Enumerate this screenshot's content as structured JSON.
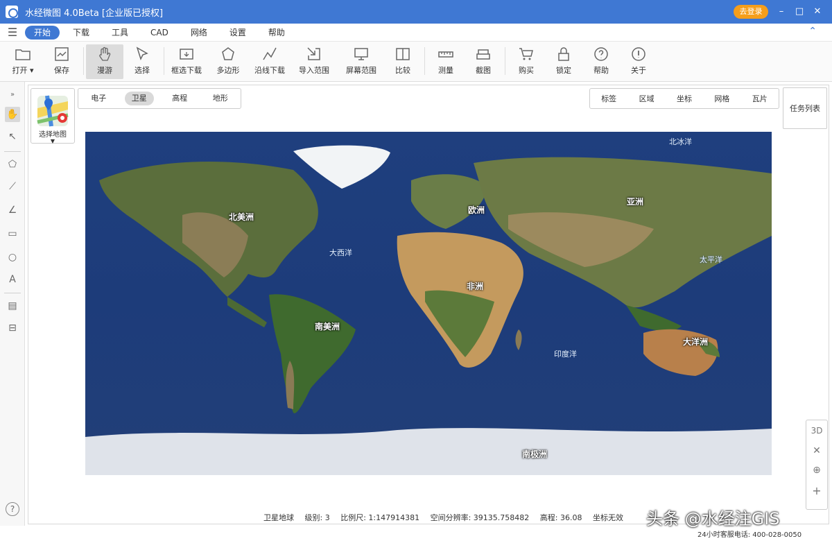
{
  "app": {
    "title": "水经微图 4.0Beta [企业版已授权]",
    "login_label": "去登录",
    "minimize": "–",
    "maximize": "□",
    "close": "✕"
  },
  "menu": {
    "toggle": "☰",
    "items": [
      "开始",
      "下载",
      "工具",
      "CAD",
      "网络",
      "设置",
      "帮助"
    ],
    "collapse": "⌃"
  },
  "toolbar": {
    "items": [
      "打开 ▾",
      "保存",
      "漫游",
      "选择",
      "框选下载",
      "多边形",
      "沿线下载",
      "导入范围",
      "屏幕范围",
      "比较",
      "测量",
      "截图",
      "购买",
      "锁定",
      "帮助",
      "关于"
    ]
  },
  "map_select": {
    "label": "选择地图"
  },
  "map_types": [
    "电子",
    "卫星",
    "高程",
    "地形"
  ],
  "right_tools": [
    "标签",
    "区域",
    "坐标",
    "网格",
    "瓦片"
  ],
  "task_list": "任务列表",
  "map": {
    "labels": {
      "beiji": "北冰洋",
      "beimei": "北美洲",
      "ouzhou": "欧洲",
      "yazhou": "亚洲",
      "daxiyang": "大西洋",
      "taipingyang": "太平洋",
      "feizhou": "非洲",
      "nanmei": "南美洲",
      "yinduyang": "印度洋",
      "dayangzhou": "大洋洲",
      "nanji": "南极洲"
    }
  },
  "zoom_panel": {
    "mode": "3D",
    "compass": "✕",
    "locate": "⊕",
    "zoom_in": "+"
  },
  "status": {
    "globe": "卫星地球",
    "level": "级别: 3",
    "scale": "比例尺: 1:147914381",
    "resolution": "空间分辨率: 39135.758482",
    "elevation": "高程: 36.08",
    "coordinate": "坐标无效"
  },
  "contact": "24小时客服电话: 400-028-0050",
  "watermark": "头条 @水经注GIS"
}
